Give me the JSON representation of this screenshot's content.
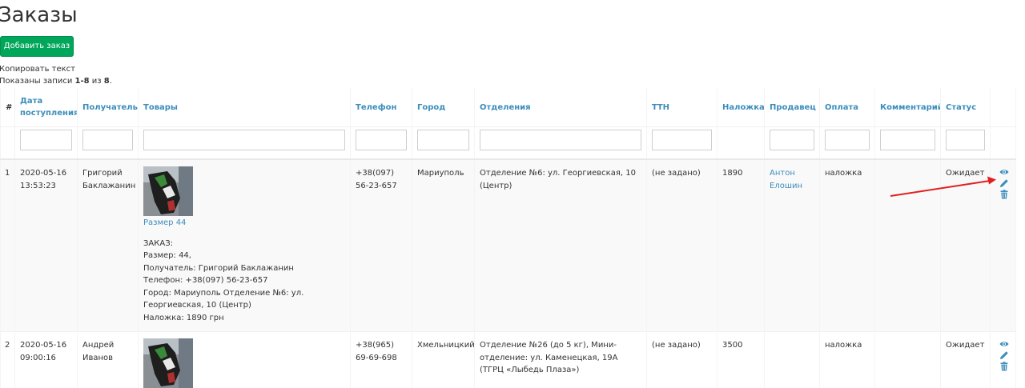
{
  "page": {
    "title": "Заказы",
    "add_button": "Добавить заказ",
    "copy_text": "Копировать текст",
    "summary_prefix": "Показаны записи ",
    "summary_range": "1-8",
    "summary_mid": " из ",
    "summary_total": "8",
    "summary_suffix": "."
  },
  "table": {
    "columns": {
      "num": "#",
      "date": "Дата поступления",
      "recipient": "Получатель",
      "goods": "Товары",
      "phone": "Телефон",
      "city": "Город",
      "branch": "Отделения",
      "ttn": "ТТН",
      "cod": "Наложка",
      "seller": "Продавец",
      "payment": "Оплата",
      "comment": "Комментарий",
      "status": "Статус"
    },
    "rows": [
      {
        "num": "1",
        "date_line1": "2020-05-16",
        "date_line2": "13:53:23",
        "recipient": "Григорий Баклажанин",
        "size_link": "Размер 44",
        "order_lines": [
          "ЗАКАЗ:",
          "Размер: 44,",
          "Получатель: Григорий Баклажанин",
          "Телефон: +38(097) 56-23-657",
          "Город: Мариуполь Отделение №6: ул. Георгиевская, 10 (Центр)",
          "Наложка: 1890 грн"
        ],
        "phone": "+38(097) 56-23-657",
        "city": "Мариуполь",
        "branch": "Отделение №6: ул. Георгиевская, 10 (Центр)",
        "ttn": "(не задано)",
        "cod": "1890",
        "seller": "Антон Елошин",
        "payment": "наложка",
        "comment": "",
        "status": "Ожидает"
      },
      {
        "num": "2",
        "date_line1": "2020-05-16",
        "date_line2": "09:00:16",
        "recipient": "Андрей Иванов",
        "phone": "+38(965) 69-69-698",
        "city": "Хмельницкий",
        "branch": "Отделение №26 (до 5 кг), Мини-отделение: ул. Каменецкая, 19А (ТГРЦ «Лыбедь Плаза»)",
        "ttn": "(не задано)",
        "cod": "3500",
        "seller": "",
        "payment": "наложка",
        "comment": "",
        "status": "Ожидает"
      }
    ]
  },
  "icons": {
    "view": "eye-icon",
    "edit": "pencil-icon",
    "delete": "trash-icon"
  },
  "colors": {
    "accent_link": "#3c8dbc",
    "button_green": "#00a65a",
    "annotation_arrow": "#e02020"
  }
}
